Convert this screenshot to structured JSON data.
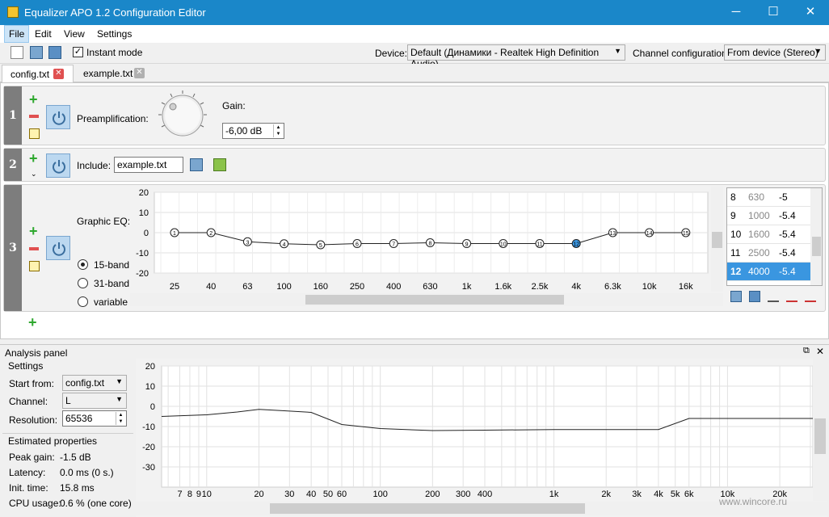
{
  "window": {
    "title": "Equalizer APO 1.2 Configuration Editor",
    "minimize": "─",
    "maximize": "☐",
    "close": "✕"
  },
  "menu": [
    "File",
    "Edit",
    "View",
    "Settings"
  ],
  "toolbar": {
    "instant_mode": "Instant mode",
    "instant_mode_checked": true,
    "device_label": "Device:",
    "device_value": "Default (Динамики - Realtek High Definition Audio)",
    "channel_label": "Channel configuration:",
    "channel_value": "From device (Stereo)"
  },
  "tabs": [
    {
      "label": "config.txt",
      "active": true
    },
    {
      "label": "example.txt",
      "active": false
    }
  ],
  "filters": {
    "f1": {
      "num": "1",
      "preamp_label": "Preamplification:",
      "gain_label": "Gain:",
      "gain_value": "-6,00 dB"
    },
    "f2": {
      "num": "2",
      "include_label": "Include:",
      "include_value": "example.txt"
    },
    "f3": {
      "num": "3",
      "eq_label": "Graphic EQ:",
      "bands": [
        "15-band",
        "31-band",
        "variable"
      ],
      "selected_band": "15-band"
    }
  },
  "chart_data": [
    {
      "type": "line",
      "x_tick_labels": [
        "25",
        "40",
        "63",
        "100",
        "160",
        "250",
        "400",
        "630",
        "1k",
        "1.6k",
        "2.5k",
        "4k",
        "6.3k",
        "10k",
        "16k"
      ],
      "y_ticks": [
        "20",
        "10",
        "0",
        "-10",
        "-20"
      ],
      "ylim": [
        -20,
        20
      ],
      "points": [
        {
          "id": "1",
          "x": "25",
          "y": 0
        },
        {
          "id": "2",
          "x": "40",
          "y": 0
        },
        {
          "id": "3",
          "x": "63",
          "y": -4.5
        },
        {
          "id": "4",
          "x": "100",
          "y": -5.5
        },
        {
          "id": "5",
          "x": "160",
          "y": -6
        },
        {
          "id": "6",
          "x": "250",
          "y": -5.4
        },
        {
          "id": "7",
          "x": "400",
          "y": -5.4
        },
        {
          "id": "8",
          "x": "630",
          "y": -5
        },
        {
          "id": "9",
          "x": "1k",
          "y": -5.4
        },
        {
          "id": "10",
          "x": "1.6k",
          "y": -5.4
        },
        {
          "id": "11",
          "x": "2.5k",
          "y": -5.4
        },
        {
          "id": "12",
          "x": "4k",
          "y": -5.4,
          "selected": true
        },
        {
          "id": "13",
          "x": "6.3k",
          "y": 0
        },
        {
          "id": "14",
          "x": "10k",
          "y": 0
        },
        {
          "id": "15",
          "x": "16k",
          "y": 0
        }
      ]
    },
    {
      "type": "line",
      "x_tick_labels": [
        "7",
        "8",
        "9",
        "10",
        "20",
        "30",
        "40",
        "50",
        "60",
        "100",
        "200",
        "300",
        "400",
        "1k",
        "2k",
        "3k",
        "4k",
        "5k",
        "6k",
        "10k",
        "20k"
      ],
      "x_tick_values": [
        7,
        8,
        9,
        10,
        20,
        30,
        40,
        50,
        60,
        100,
        200,
        300,
        400,
        1000,
        2000,
        3000,
        4000,
        5000,
        6000,
        10000,
        20000
      ],
      "y_ticks": [
        "20",
        "10",
        "0",
        "-10",
        "-20",
        "-30"
      ],
      "ylim": [
        -40,
        20
      ],
      "xlim": [
        5.5,
        31000
      ],
      "x": [
        5.5,
        10,
        15,
        20,
        28,
        40,
        60,
        100,
        200,
        400,
        1000,
        4000,
        6000,
        31000
      ],
      "y": [
        -5,
        -4.2,
        -2.8,
        -1.5,
        -2.2,
        -3,
        -9,
        -11,
        -12,
        -11.8,
        -11.5,
        -11.5,
        -6,
        -6
      ]
    }
  ],
  "eq_table": [
    {
      "band": "8",
      "freq": "630",
      "gain": "-5"
    },
    {
      "band": "9",
      "freq": "1000",
      "gain": "-5.4"
    },
    {
      "band": "10",
      "freq": "1600",
      "gain": "-5.4"
    },
    {
      "band": "11",
      "freq": "2500",
      "gain": "-5.4"
    },
    {
      "band": "12",
      "freq": "4000",
      "gain": "-5.4",
      "selected": true
    }
  ],
  "analysis": {
    "title": "Analysis panel",
    "settings_title": "Settings",
    "start_from_label": "Start from:",
    "start_from_value": "config.txt",
    "channel_label": "Channel:",
    "channel_value": "L",
    "resolution_label": "Resolution:",
    "resolution_value": "65536",
    "estimated_title": "Estimated properties",
    "props": [
      {
        "label": "Peak gain:",
        "value": "-1.5 dB"
      },
      {
        "label": "Latency:",
        "value": "0.0 ms (0 s.)"
      },
      {
        "label": "Init. time:",
        "value": "15.8 ms"
      },
      {
        "label": "CPU usage:",
        "value": "0.6 % (one core)"
      }
    ]
  },
  "watermark": "www.wincore.ru",
  "colors": {
    "titlebar": "#1a87c9",
    "selection": "#3a96e0",
    "plus": "#2ea82e",
    "minus": "#e05050"
  }
}
